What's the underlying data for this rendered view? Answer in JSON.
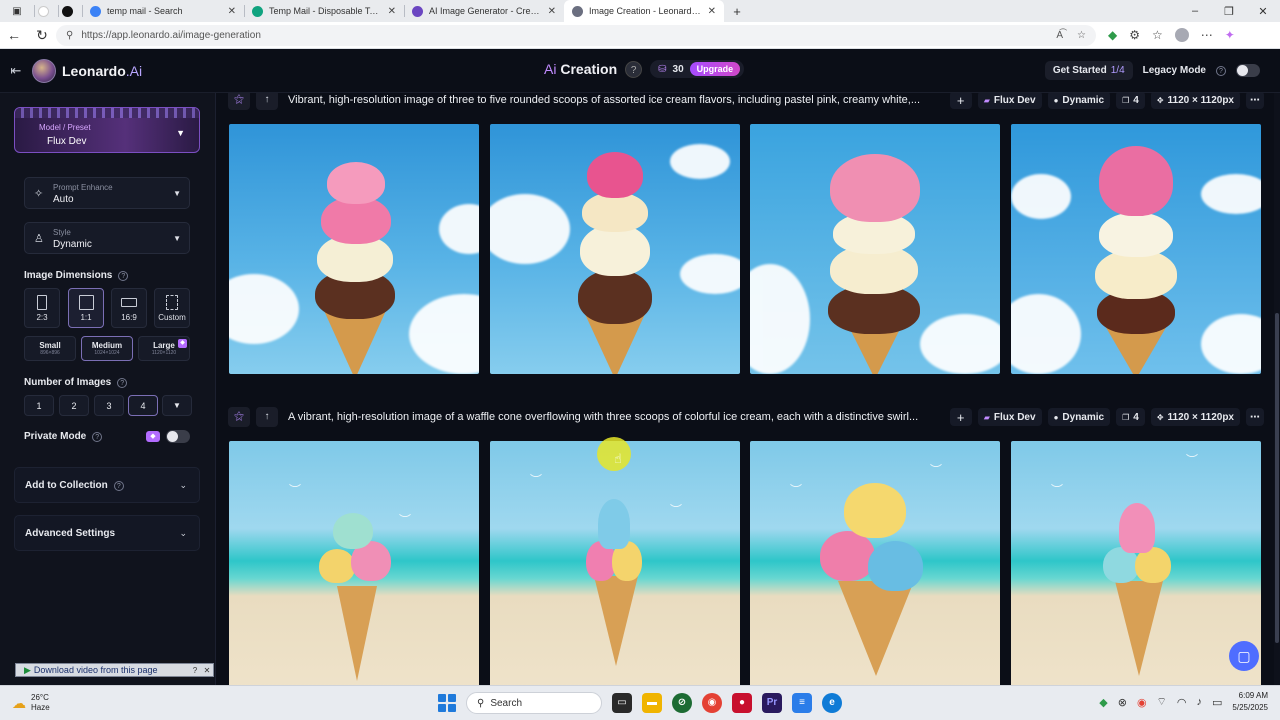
{
  "browser": {
    "tabs": [
      {
        "title": "temp mail - Search",
        "favicon_color": "#3b82f6",
        "active": false
      },
      {
        "title": "Temp Mail - Disposable Tempora...",
        "favicon_color": "#10a37f",
        "active": false
      },
      {
        "title": "AI Image Generator - Create Art, ...",
        "favicon_color": "#6b46c1",
        "active": false
      },
      {
        "title": "Image Creation - Leonardo.Ai",
        "favicon_color": "#6b6f80",
        "active": true
      }
    ],
    "url": "https://app.leonardo.ai/image-generation"
  },
  "header": {
    "brand_main": "Leonardo",
    "brand_suffix": ".Ai",
    "title_prefix": "Ai",
    "title_main": "Creation",
    "tokens": "30",
    "upgrade_label": "Upgrade",
    "get_started_label": "Get Started",
    "get_started_progress": "1/4",
    "legacy_mode_label": "Legacy Mode"
  },
  "sidebar": {
    "model_label": "Model / Preset",
    "model_value": "Flux Dev",
    "prompt_enhance_label": "Prompt Enhance",
    "prompt_enhance_value": "Auto",
    "style_label": "Style",
    "style_value": "Dynamic",
    "image_dimensions_label": "Image Dimensions",
    "aspect_ratios": [
      "2:3",
      "1:1",
      "16:9",
      "Custom"
    ],
    "selected_aspect": "1:1",
    "sizes": [
      {
        "label": "Small",
        "dims": "896×896"
      },
      {
        "label": "Medium",
        "dims": "1024×1024"
      },
      {
        "label": "Large",
        "dims": "1120×1120"
      }
    ],
    "selected_size": "Medium",
    "number_of_images_label": "Number of Images",
    "image_counts": [
      "1",
      "2",
      "3",
      "4"
    ],
    "selected_count": "4",
    "private_mode_label": "Private Mode",
    "add_to_collection_label": "Add to Collection",
    "advanced_settings_label": "Advanced Settings"
  },
  "generations": [
    {
      "prompt": "Vibrant, high-resolution image of three to five rounded scoops of assorted ice cream flavors, including pastel pink, creamy white,...",
      "model": "Flux Dev",
      "style": "Dynamic",
      "count": "4",
      "dimensions": "1120 × 1120px"
    },
    {
      "prompt": "A vibrant, high-resolution image of a waffle cone overflowing with three scoops of colorful ice cream, each with a distinctive swirl...",
      "model": "Flux Dev",
      "style": "Dynamic",
      "count": "4",
      "dimensions": "1120 × 1120px"
    }
  ],
  "extension_bar": {
    "download_label": "Download video from this page"
  },
  "taskbar": {
    "temperature": "26°C",
    "weather": "Haze",
    "search_placeholder": "Search",
    "time": "6:09 AM",
    "date": "5/25/2025"
  },
  "colors": {
    "accent_purple": "#a64cff",
    "app_bg": "#0b0e17",
    "sidebar_bg": "#10131d"
  }
}
